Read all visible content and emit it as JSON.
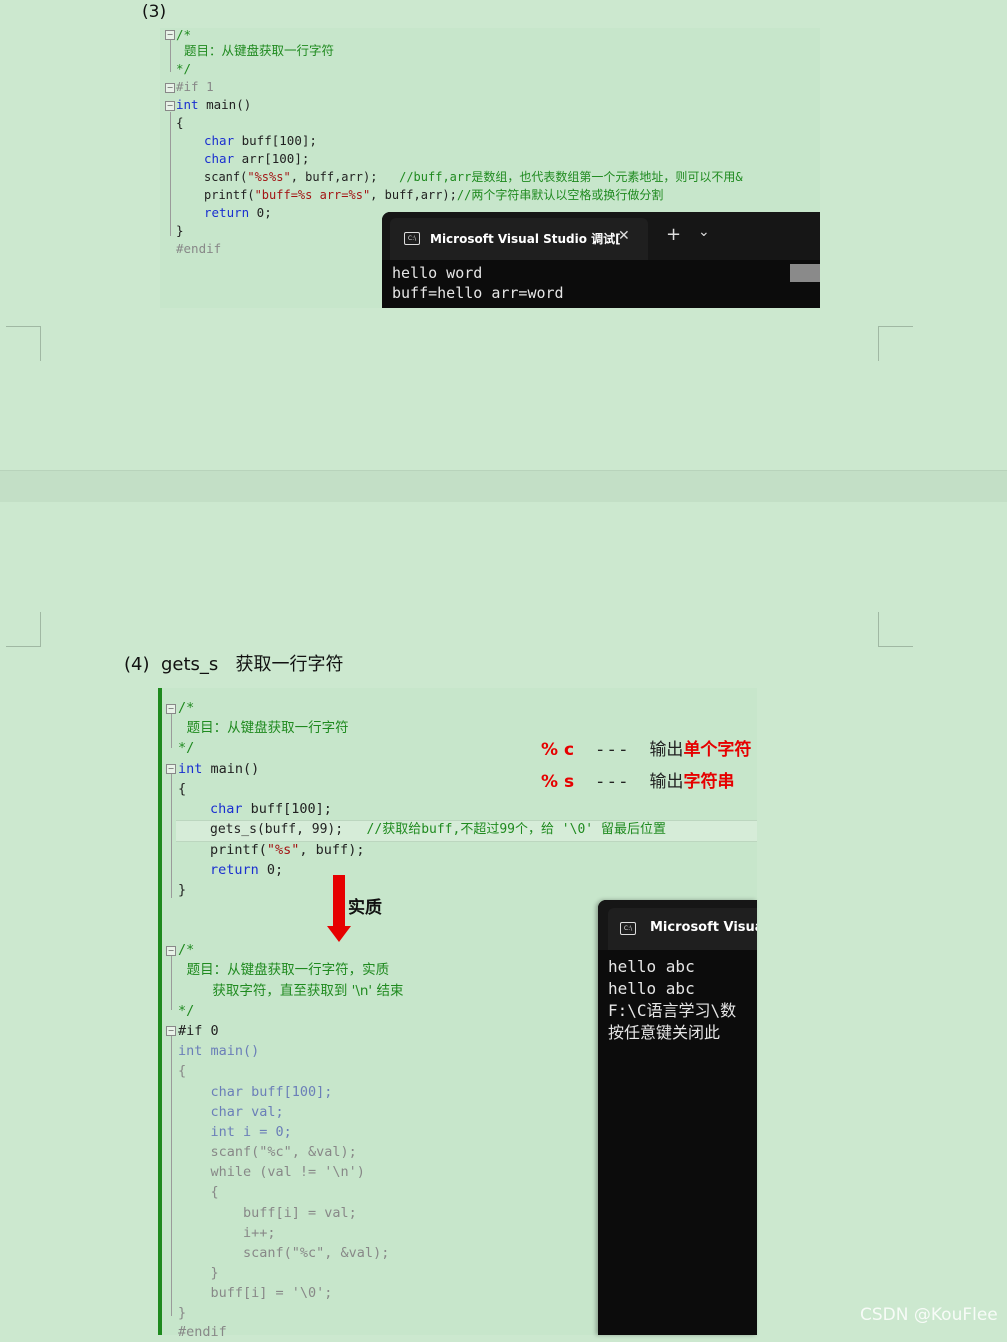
{
  "section3": {
    "label": "(3)",
    "code": {
      "l1": "/*",
      "l2": "  题目：从键盘获取一行字符",
      "l3": "*/",
      "l4": "#if 1",
      "l5_kw": "int",
      "l5_rest": " main()",
      "l6": "{",
      "l7_kw": "char",
      "l7_rest": " buff[100];",
      "l8_kw": "char",
      "l8_rest": " arr[100];",
      "l9_fn": "scanf(",
      "l9_str": "\"%s%s\"",
      "l9_rest": ", buff,arr);",
      "l9_cmt": "   //buff,arr是数组，也代表数组第一个元素地址，则可以不用&",
      "l10_fn": "printf(",
      "l10_str": "\"buff=%s arr=%s\"",
      "l10_rest": ", buff,arr);",
      "l10_cmt": "//两个字符串默认以空格或换行做分割",
      "l11_kw": "return",
      "l11_rest": " 0;",
      "l12": "}",
      "l13": "#endif"
    },
    "terminal": {
      "tab_title": "Microsoft Visual Studio 调试[",
      "close": "✕",
      "add": "+",
      "dropdown": "⌄",
      "line1": "hello word",
      "line2": "buff=hello arr=word"
    }
  },
  "section4": {
    "heading_num": "(4)",
    "heading_fn": "gets_s",
    "heading_text": "获取一行字符",
    "code_a": {
      "l1": "/*",
      "l2": "  题目：从键盘获取一行字符",
      "l3": "*/",
      "l4_kw": "int",
      "l4_rest": " main()",
      "l5": "{",
      "l6_kw": "char",
      "l6_rest": " buff[100];",
      "l7_fn": "gets_s",
      "l7_rest": "(buff, 99);",
      "l7_cmt": "   //获取给buff,不超过99个，给 '\\0' 留最后位置",
      "l8_fn": "printf(",
      "l8_str": "\"%s\"",
      "l8_rest": ", buff);",
      "l9_kw": "return",
      "l9_rest": " 0;",
      "l10": "}"
    },
    "notes": {
      "pc": "% c",
      "pc_dash": "- - -",
      "pc_text_a": "输出",
      "pc_text_b": "单个字符",
      "ps": "% s",
      "ps_dash": "- - -",
      "ps_text_a": "输出",
      "ps_text_b": "字符串"
    },
    "arrow_label": "实质",
    "code_b": {
      "l1": "/*",
      "l2": "  题目：从键盘获取一行字符，实质",
      "l3": "        获取字符，直至获取到 '\\n' 结束",
      "l4": "*/",
      "l5": "#if 0",
      "l6": "int main()",
      "l7": "{",
      "l8": "    char buff[100];",
      "l9": "    char val;",
      "l10": "    int i = 0;",
      "l11": "    scanf(\"%c\", &val);",
      "l12": "    while (val != '\\n')",
      "l13": "    {",
      "l14": "        buff[i] = val;",
      "l15": "        i++;",
      "l16": "        scanf(\"%c\", &val);",
      "l17": "    }",
      "l18": "    buff[i] = '\\0';",
      "l19": "}",
      "l20": "#endif"
    },
    "terminal": {
      "tab_title": "Microsoft Visual",
      "line1": "hello abc",
      "line2": "hello abc",
      "line3": "F:\\C语言学习\\数",
      "line4": "按任意键关闭此"
    }
  },
  "watermark": "CSDN @KouFlee",
  "colors": {
    "page_bg": "#cce8cf",
    "comment": "#1f8a1f",
    "keyword": "#1a2fd0",
    "accent_red": "#e60000",
    "terminal_bg": "#0c0c0c"
  }
}
